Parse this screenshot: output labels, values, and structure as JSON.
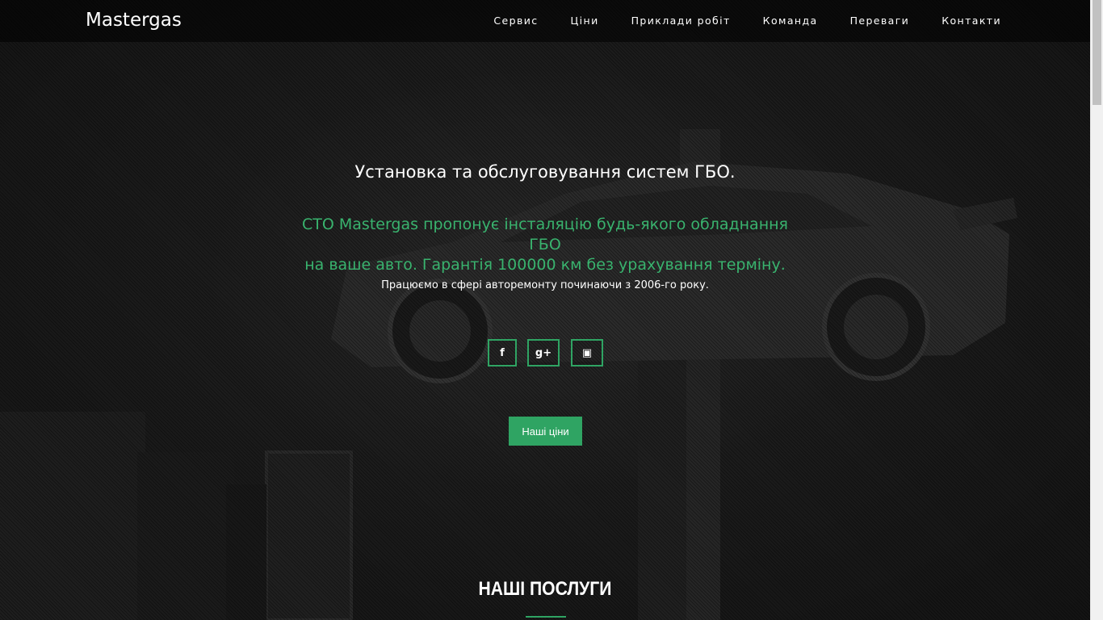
{
  "brand": "Mastergas",
  "nav": {
    "items": [
      "Сервис",
      "Ціни",
      "Приклади робіт",
      "Команда",
      "Переваги",
      "Контакти"
    ]
  },
  "hero": {
    "title": "Установка та обслуговування систем ГБО.",
    "subtitle_line1": "СТО Mastergas пропонує інсталяцію будь-якого обладнання ГБО",
    "subtitle_line2": "на ваше авто. Гарантія 100000 км без урахування терміну.",
    "note": "Працюємо в сфері авторемонту починаючи з 2006-го року.",
    "social": [
      {
        "icon": "facebook-icon",
        "glyph": "f"
      },
      {
        "icon": "google-plus-icon",
        "glyph": "g+"
      },
      {
        "icon": "instagram-icon",
        "glyph": "▣"
      }
    ],
    "cta_label": "Наші ціни"
  },
  "section": {
    "title": "НАШІ ПОСЛУГИ"
  },
  "colors": {
    "accent": "#2fa463",
    "accent_text": "#39b36e",
    "background": "#121212"
  }
}
